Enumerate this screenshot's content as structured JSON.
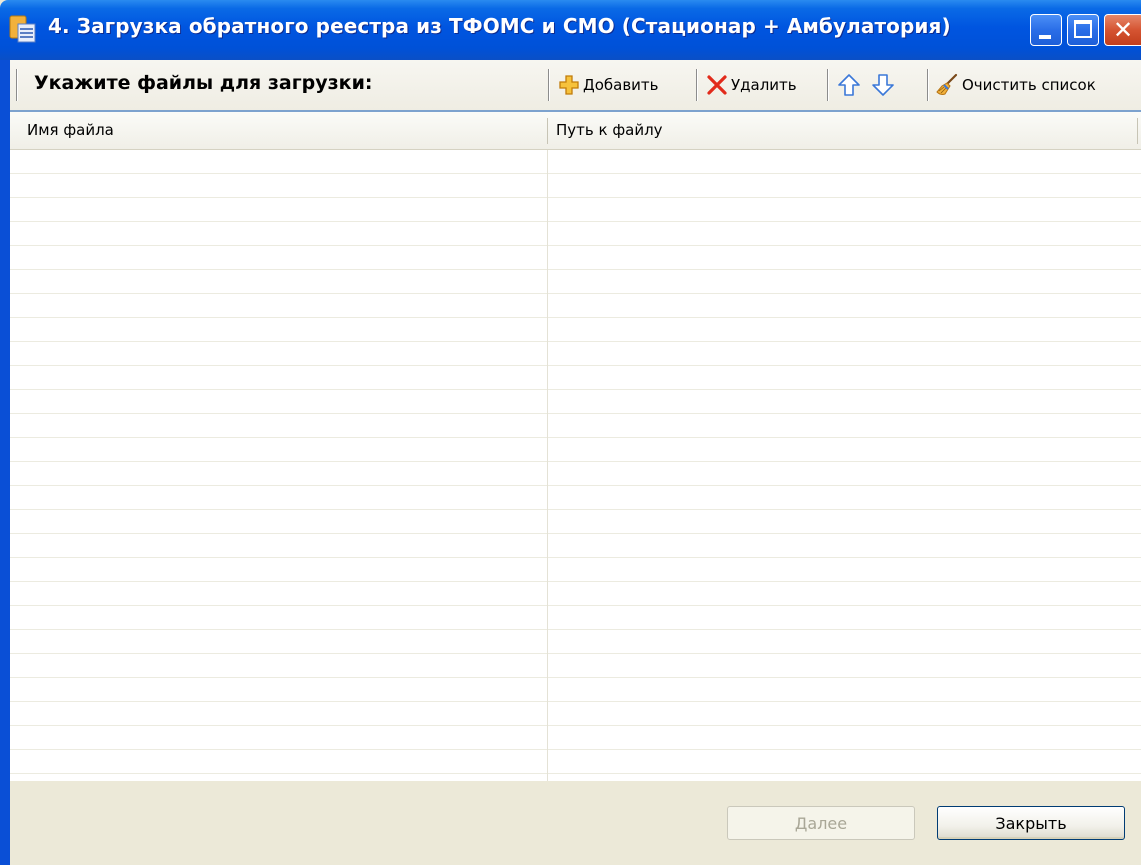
{
  "window": {
    "title": "4. Загрузка обратного реестра из ТФОМС и СМО (Стационар + Амбулатория)",
    "controls": [
      "minimize",
      "maximize",
      "close"
    ]
  },
  "toolbar": {
    "label": "Укажите файлы для загрузки:",
    "add_label": "Добавить",
    "delete_label": "Удалить",
    "clear_label": "Очистить список"
  },
  "grid": {
    "columns": [
      "Имя файла",
      "Путь к файлу"
    ],
    "rows": []
  },
  "footer": {
    "next_label": "Далее",
    "close_label": "Закрыть",
    "next_enabled": false
  },
  "colors": {
    "titlebar": "#0055e0",
    "close_button": "#d55432",
    "add_icon": "#f2b01e",
    "delete_icon": "#e22b1b",
    "arrow_icon": "#3b78d8"
  }
}
